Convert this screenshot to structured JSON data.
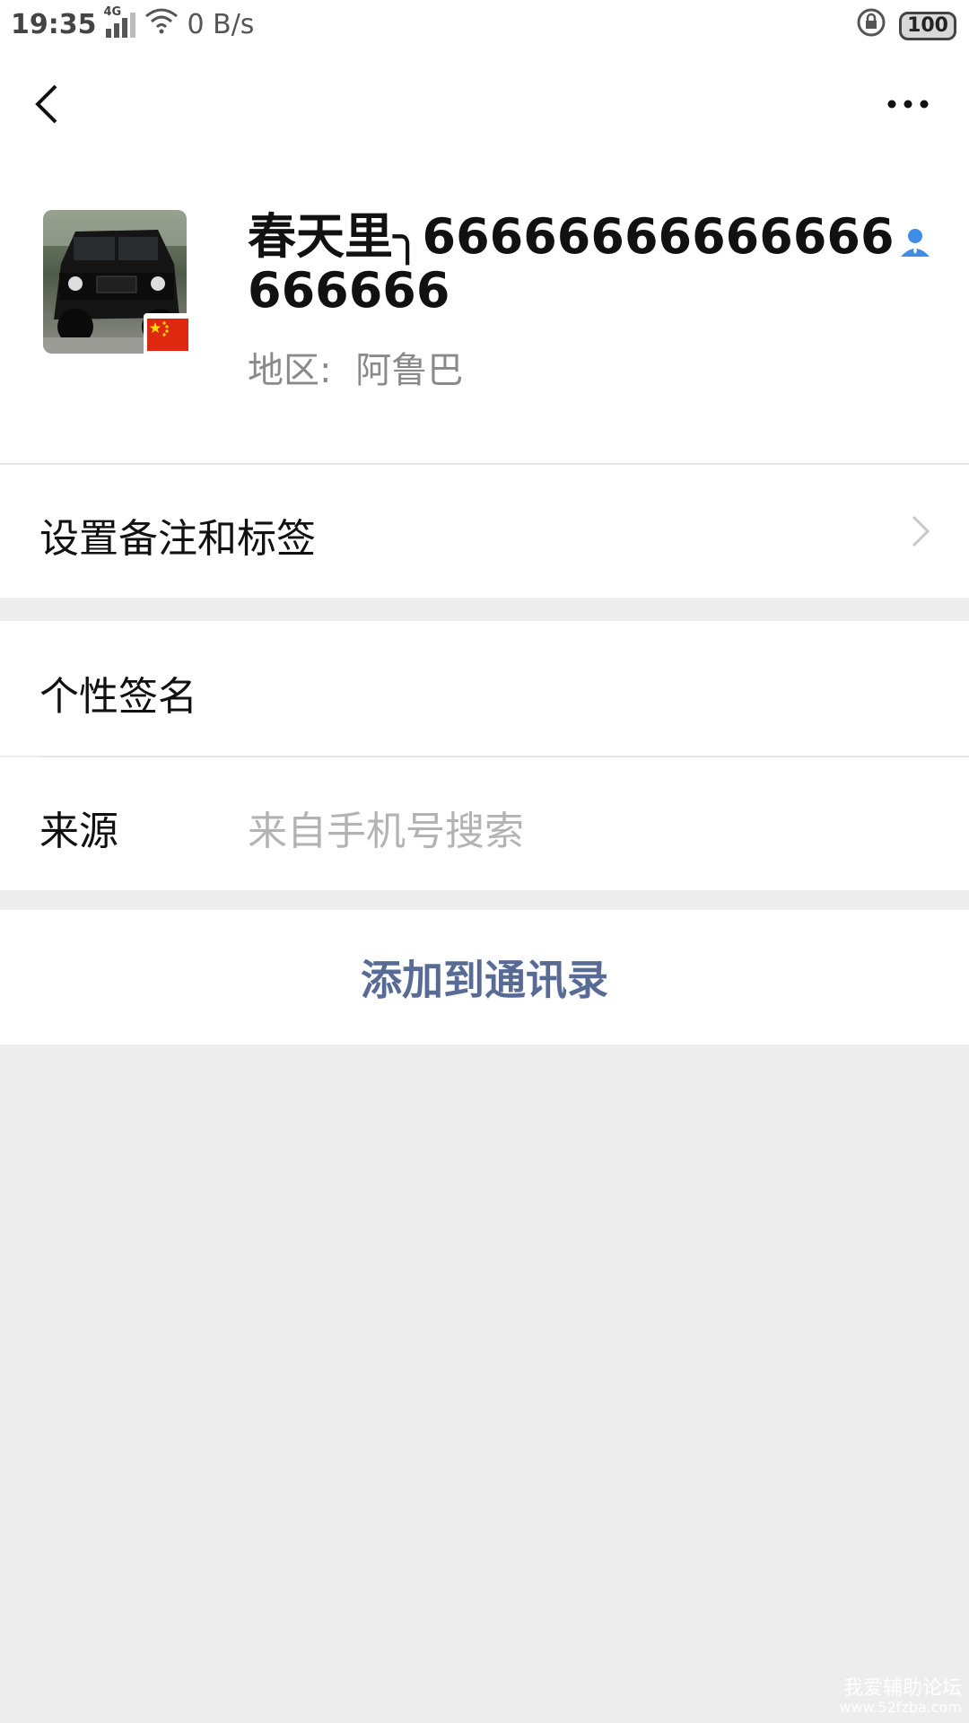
{
  "status_bar": {
    "time": "19:35",
    "network": "4G",
    "speed": "0 B/s",
    "battery": "100"
  },
  "nav": {
    "back_icon": "chevron-left-icon",
    "more_icon": "more-dots-icon"
  },
  "profile": {
    "name": "春天里╮66666666666666666666",
    "region_label": "地区:",
    "region_value": "阿鲁巴",
    "flag": "china-flag-icon",
    "contact_icon": "contact-person-icon"
  },
  "rows": {
    "remark": "设置备注和标签",
    "signature": "个性签名",
    "source_label": "来源",
    "source_value": "来自手机号搜索"
  },
  "actions": {
    "add_contact": "添加到通讯录"
  },
  "watermark": {
    "line1": "我爱辅助论坛",
    "line2": "www.52fzba.com"
  },
  "colors": {
    "background": "#ededed",
    "surface": "#ffffff",
    "accent": "#576b95",
    "secondary_text": "#8a8a8a",
    "contact_icon": "#3f8de6"
  }
}
